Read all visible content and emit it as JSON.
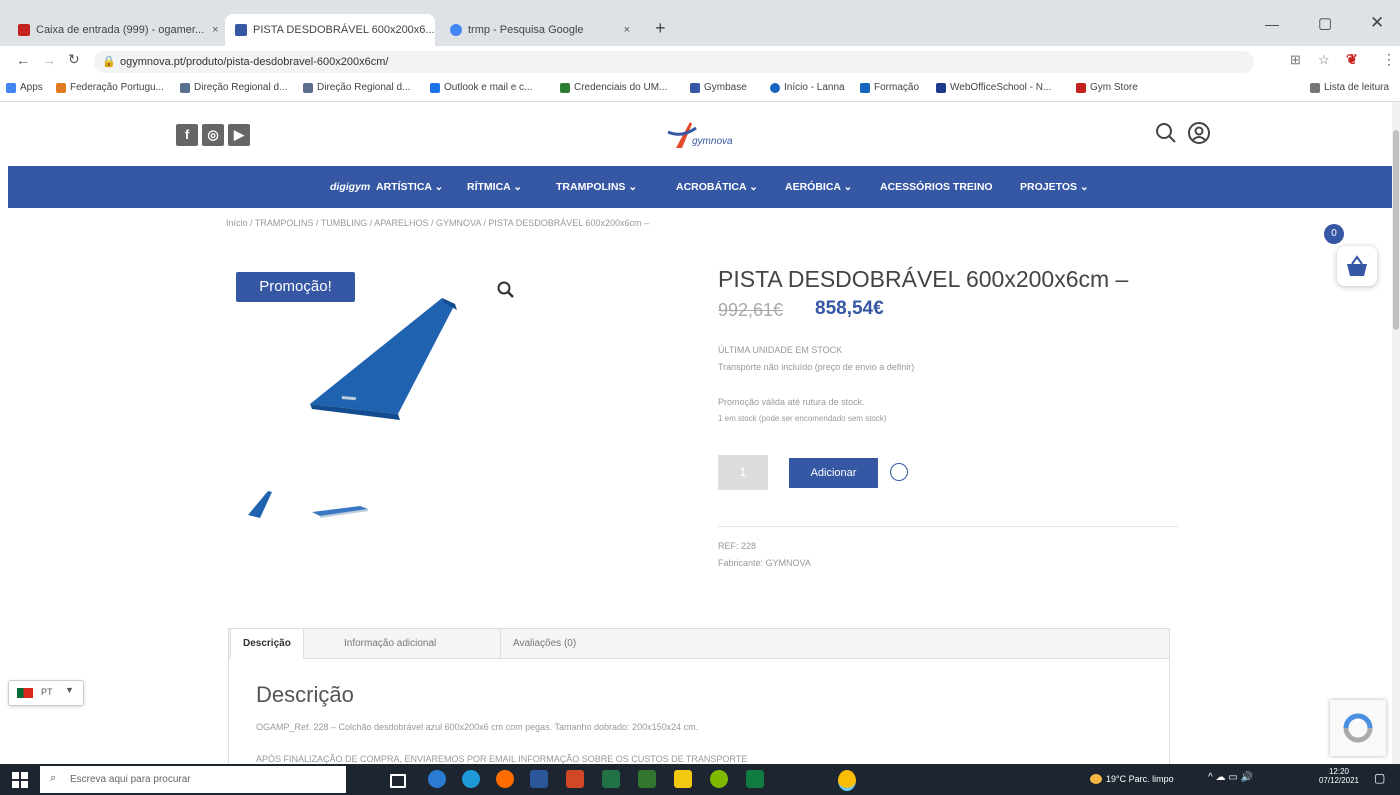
{
  "browser": {
    "tabs": [
      {
        "label": "Caixa de entrada (999) - ogamer...",
        "favicon_color": "#c5221f"
      },
      {
        "label": "PISTA DESDOBRÁVEL 600x200x6...",
        "favicon_color": "#3557a4"
      },
      {
        "label": "trmp - Pesquisa Google",
        "favicon_color": "#4285f4"
      }
    ],
    "url": "ogymnova.pt/produto/pista-desdobravel-600x200x6cm/",
    "bookmarks": [
      "Apps",
      "Federação Portugu...",
      "Direção Regional d...",
      "Direção Regional d...",
      "Outlook e mail e c...",
      "Credenciais do UM...",
      "Gymbase",
      "Início - Lanna",
      "Formação",
      "WebOfficeSchool - N...",
      "Gym Store"
    ],
    "reading_list": "Lista de leitura"
  },
  "site": {
    "logo": "gymnova",
    "nav": [
      "digigym",
      "ARTÍSTICA ⌄",
      "RÍTMICA ⌄",
      "TRAMPOLINS ⌄",
      "ACROBÁTICA ⌄",
      "AERÓBICA ⌄",
      "ACESSÓRIOS TREINO",
      "PROJETOS ⌄"
    ],
    "breadcrumb": "Início / TRAMPOLINS / TUMBLING / APARELHOS / GYMNOVA / PISTA DESDOBRÁVEL 600x200x6cm –",
    "cart_count": "0",
    "language": "PT"
  },
  "product": {
    "sale_badge": "Promoção!",
    "title": "PISTA DESDOBRÁVEL 600x200x6cm –",
    "old_price": "992,61€",
    "price": "858,54€",
    "stock": "ÚLTIMA UNIDADE EM STOCK",
    "shipping": "Transporte não incluído (preço de envio a definir)",
    "promo_note": "Promoção válida até rutura de stock.",
    "stock_note": "1 em stock (pode ser encomendado sem stock)",
    "qty": "1",
    "add_button": "Adicionar",
    "ref": "REF: 228",
    "maker": "Fabricante: GYMNOVA"
  },
  "tabs": {
    "items": [
      "Descrição",
      "Informação adicional",
      "Avaliações (0)"
    ],
    "heading": "Descrição",
    "body": "OGAMP_Ref. 228 – Colchão desdobrável azul 600x200x6 cm com pegas. Tamanho dobrado: 200x150x24 cm.",
    "body2": "APÓS FINALIZAÇÃO DE COMPRA, ENVIAREMOS POR EMAIL INFORMAÇÃO SOBRE OS CUSTOS DE TRANSPORTE"
  },
  "taskbar": {
    "search": "Escreva aqui para procurar",
    "weather": "19°C Parc. limpo",
    "time": "12:20",
    "date": "07/12/2021"
  },
  "colors": {
    "brand": "#3557a4"
  }
}
